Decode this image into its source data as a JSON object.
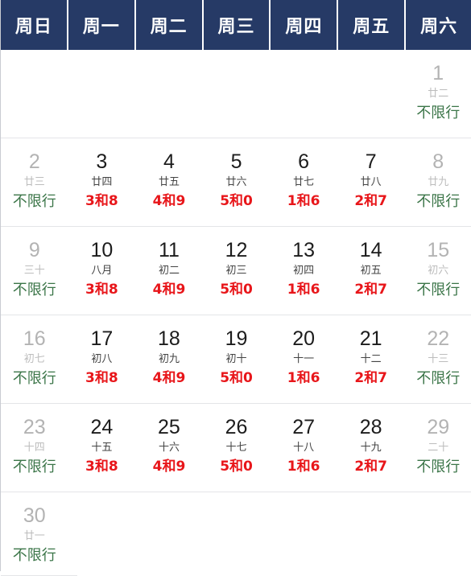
{
  "header": {
    "weekdays": [
      "周日",
      "周一",
      "周二",
      "周三",
      "周四",
      "周五",
      "周六"
    ]
  },
  "colors": {
    "header_bg": "#263a66",
    "header_text": "#ffffff",
    "restricted_text": "#e8161a",
    "free_text": "#3b7548",
    "weekend_num": "#b3b3b3",
    "weekday_num": "#1c1c1c",
    "lunar_text": "#444444",
    "rule_line": "#e4e5e8"
  },
  "labels": {
    "free_tag": "不限行"
  },
  "weeks": [
    {
      "days": [
        {
          "num": "",
          "lunar": "",
          "tag": "",
          "type": "empty"
        },
        {
          "num": "",
          "lunar": "",
          "tag": "",
          "type": "empty"
        },
        {
          "num": "",
          "lunar": "",
          "tag": "",
          "type": "empty"
        },
        {
          "num": "",
          "lunar": "",
          "tag": "",
          "type": "empty"
        },
        {
          "num": "",
          "lunar": "",
          "tag": "",
          "type": "empty"
        },
        {
          "num": "",
          "lunar": "",
          "tag": "",
          "type": "empty"
        },
        {
          "num": "1",
          "lunar": "廿二",
          "tag": "不限行",
          "type": "weekend"
        }
      ]
    },
    {
      "days": [
        {
          "num": "2",
          "lunar": "廿三",
          "tag": "不限行",
          "type": "weekend"
        },
        {
          "num": "3",
          "lunar": "廿四",
          "tag": "3和8",
          "type": "restricted"
        },
        {
          "num": "4",
          "lunar": "廿五",
          "tag": "4和9",
          "type": "restricted"
        },
        {
          "num": "5",
          "lunar": "廿六",
          "tag": "5和0",
          "type": "restricted"
        },
        {
          "num": "6",
          "lunar": "廿七",
          "tag": "1和6",
          "type": "restricted"
        },
        {
          "num": "7",
          "lunar": "廿八",
          "tag": "2和7",
          "type": "restricted"
        },
        {
          "num": "8",
          "lunar": "廿九",
          "tag": "不限行",
          "type": "weekend"
        }
      ]
    },
    {
      "days": [
        {
          "num": "9",
          "lunar": "三十",
          "tag": "不限行",
          "type": "weekend"
        },
        {
          "num": "10",
          "lunar": "八月",
          "tag": "3和8",
          "type": "restricted"
        },
        {
          "num": "11",
          "lunar": "初二",
          "tag": "4和9",
          "type": "restricted"
        },
        {
          "num": "12",
          "lunar": "初三",
          "tag": "5和0",
          "type": "restricted"
        },
        {
          "num": "13",
          "lunar": "初四",
          "tag": "1和6",
          "type": "restricted"
        },
        {
          "num": "14",
          "lunar": "初五",
          "tag": "2和7",
          "type": "restricted"
        },
        {
          "num": "15",
          "lunar": "初六",
          "tag": "不限行",
          "type": "weekend"
        }
      ]
    },
    {
      "days": [
        {
          "num": "16",
          "lunar": "初七",
          "tag": "不限行",
          "type": "weekend"
        },
        {
          "num": "17",
          "lunar": "初八",
          "tag": "3和8",
          "type": "restricted"
        },
        {
          "num": "18",
          "lunar": "初九",
          "tag": "4和9",
          "type": "restricted"
        },
        {
          "num": "19",
          "lunar": "初十",
          "tag": "5和0",
          "type": "restricted"
        },
        {
          "num": "20",
          "lunar": "十一",
          "tag": "1和6",
          "type": "restricted"
        },
        {
          "num": "21",
          "lunar": "十二",
          "tag": "2和7",
          "type": "restricted"
        },
        {
          "num": "22",
          "lunar": "十三",
          "tag": "不限行",
          "type": "weekend"
        }
      ]
    },
    {
      "days": [
        {
          "num": "23",
          "lunar": "十四",
          "tag": "不限行",
          "type": "weekend"
        },
        {
          "num": "24",
          "lunar": "十五",
          "tag": "3和8",
          "type": "restricted"
        },
        {
          "num": "25",
          "lunar": "十六",
          "tag": "4和9",
          "type": "restricted"
        },
        {
          "num": "26",
          "lunar": "十七",
          "tag": "5和0",
          "type": "restricted"
        },
        {
          "num": "27",
          "lunar": "十八",
          "tag": "1和6",
          "type": "restricted"
        },
        {
          "num": "28",
          "lunar": "十九",
          "tag": "2和7",
          "type": "restricted"
        },
        {
          "num": "29",
          "lunar": "二十",
          "tag": "不限行",
          "type": "weekend"
        }
      ]
    },
    {
      "days": [
        {
          "num": "30",
          "lunar": "廿一",
          "tag": "不限行",
          "type": "weekend"
        },
        {
          "num": "",
          "lunar": "",
          "tag": "",
          "type": "empty"
        },
        {
          "num": "",
          "lunar": "",
          "tag": "",
          "type": "empty"
        },
        {
          "num": "",
          "lunar": "",
          "tag": "",
          "type": "empty"
        },
        {
          "num": "",
          "lunar": "",
          "tag": "",
          "type": "empty"
        },
        {
          "num": "",
          "lunar": "",
          "tag": "",
          "type": "empty"
        },
        {
          "num": "",
          "lunar": "",
          "tag": "",
          "type": "empty"
        }
      ]
    }
  ]
}
